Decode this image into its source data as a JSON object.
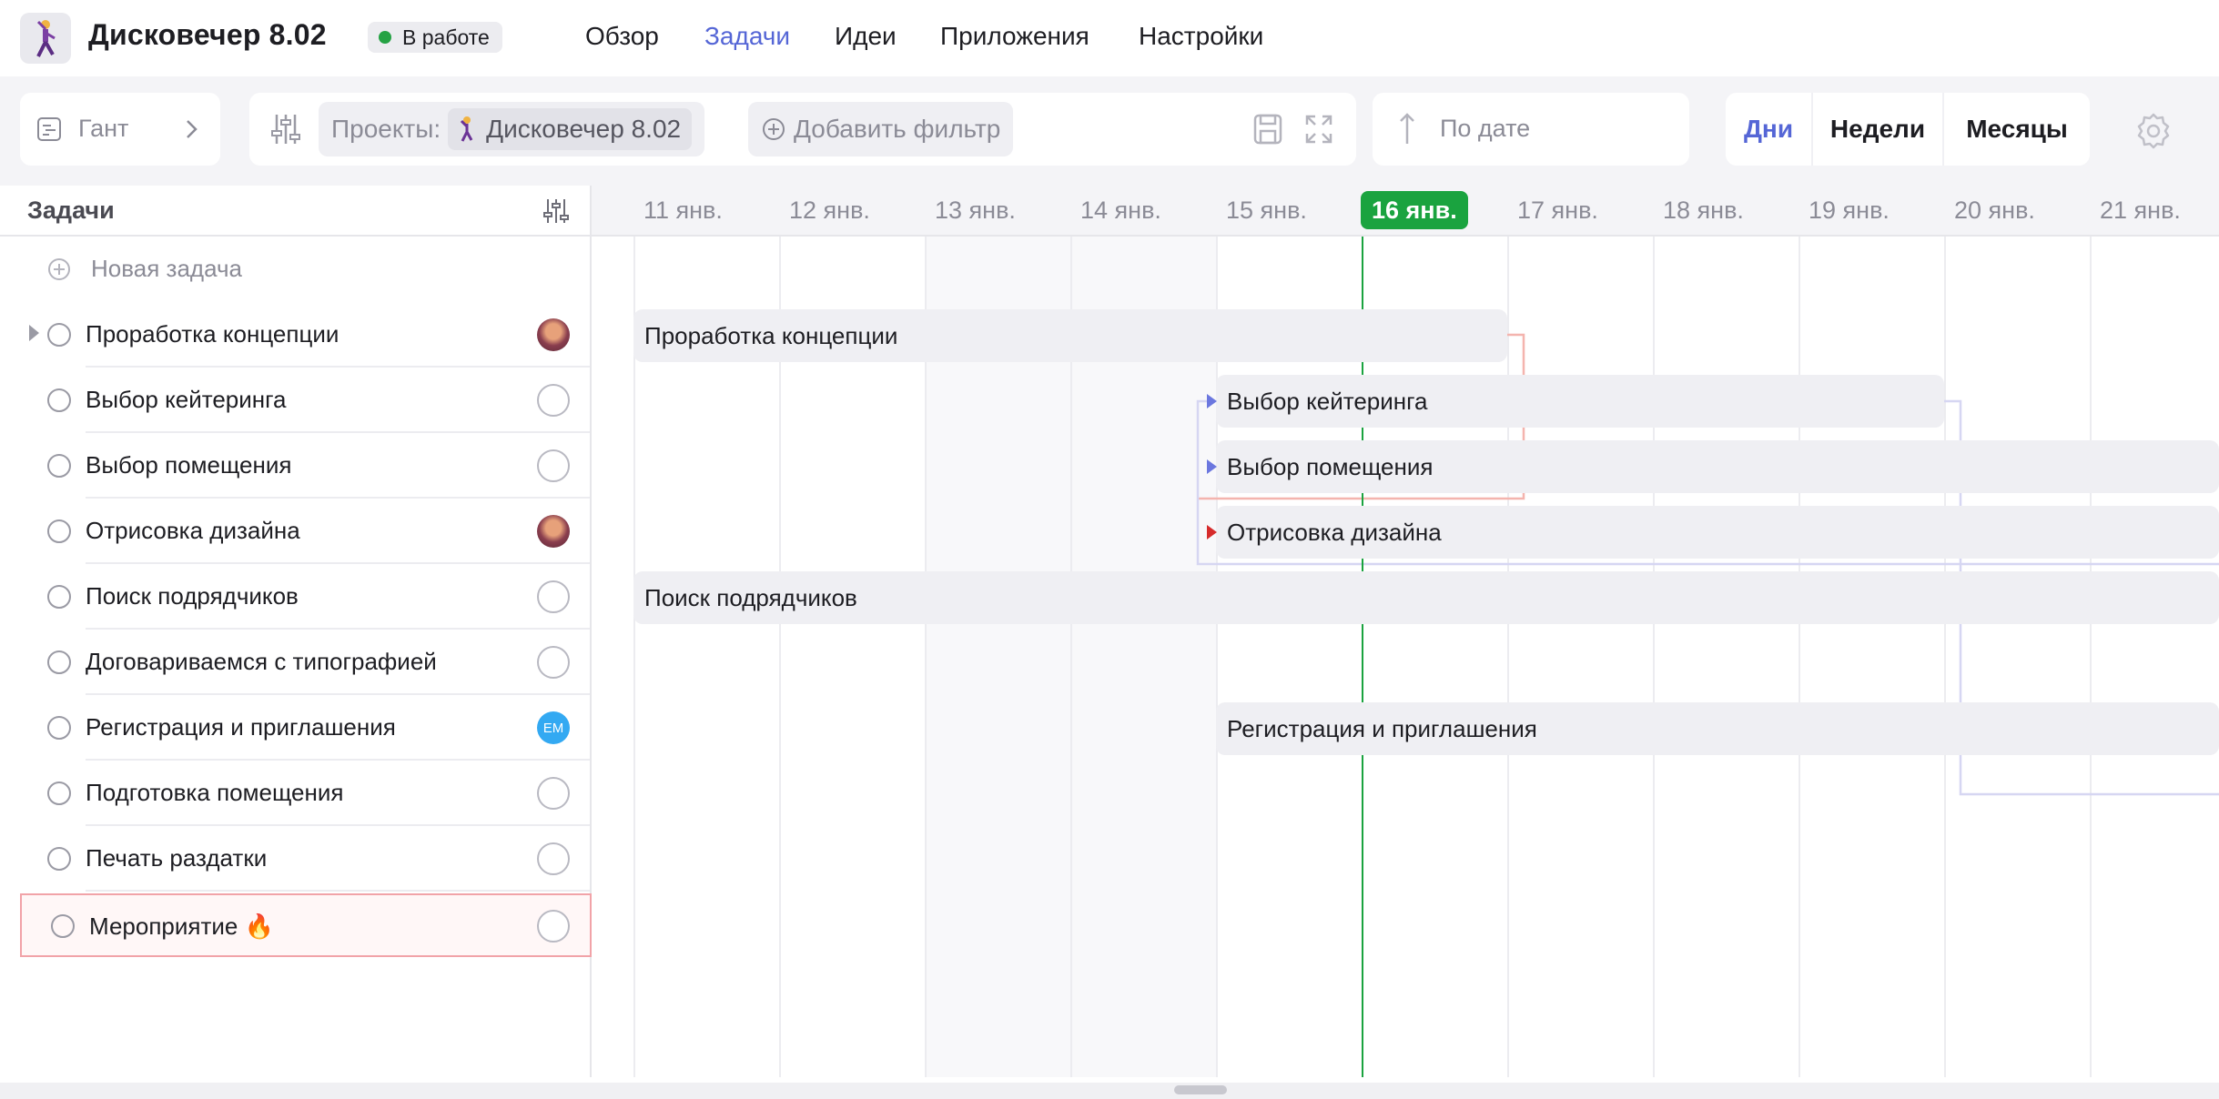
{
  "header": {
    "project_title": "Дисковечер 8.02",
    "status": "В работе",
    "status_color": "#25a244",
    "nav": [
      {
        "label": "Обзор",
        "active": false
      },
      {
        "label": "Задачи",
        "active": true
      },
      {
        "label": "Идеи",
        "active": false
      },
      {
        "label": "Приложения",
        "active": false
      },
      {
        "label": "Настройки",
        "active": false
      }
    ]
  },
  "toolbar": {
    "view": "Гант",
    "filter_label": "Проекты:",
    "filter_value": "Дисковечер 8.02",
    "add_filter": "Добавить фильтр",
    "sort": "По дате",
    "scales": [
      "Дни",
      "Недели",
      "Месяцы"
    ],
    "active_scale": "Дни"
  },
  "tasks": {
    "title": "Задачи",
    "new_task": "Новая задача",
    "items": [
      {
        "name": "Проработка концепции",
        "assignee": "photo",
        "expandable": true
      },
      {
        "name": "Выбор кейтеринга",
        "assignee": "none"
      },
      {
        "name": "Выбор помещения",
        "assignee": "none"
      },
      {
        "name": "Отрисовка дизайна",
        "assignee": "photo"
      },
      {
        "name": "Поиск подрядчиков",
        "assignee": "none"
      },
      {
        "name": "Договариваемся с типографией",
        "assignee": "none"
      },
      {
        "name": "Регистрация и приглашения",
        "assignee": "EM"
      },
      {
        "name": "Подготовка помещения",
        "assignee": "none"
      },
      {
        "name": "Печать раздатки",
        "assignee": "none"
      },
      {
        "name": "Мероприятие 🔥",
        "assignee": "none",
        "selected": true
      }
    ]
  },
  "timeline": {
    "days": [
      "11 янв.",
      "12 янв.",
      "13 янв.",
      "14 янв.",
      "15 янв.",
      "16 янв.",
      "17 янв.",
      "18 янв.",
      "19 янв.",
      "20 янв.",
      "21 янв."
    ],
    "today": "16 янв.",
    "today_color": "#1aa33f",
    "bars": [
      {
        "label": "Проработка концепции"
      },
      {
        "label": "Выбор кейтеринга"
      },
      {
        "label": "Выбор помещения"
      },
      {
        "label": "Отрисовка дизайна"
      },
      {
        "label": "Поиск подрядчиков"
      },
      {
        "label": "Регистрация и приглашения"
      }
    ]
  }
}
